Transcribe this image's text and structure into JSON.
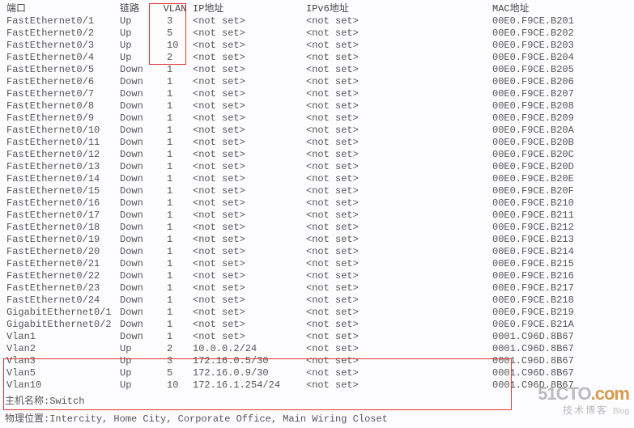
{
  "headers": {
    "port": "端口",
    "link": "链路",
    "vlan": "VLAN",
    "ip": "IP地址",
    "ipv6": "IPv6地址",
    "mac": "MAC地址"
  },
  "rows": [
    {
      "port": "FastEthernet0/1",
      "link": "Up",
      "vlan": "3",
      "ip": "<not set>",
      "ipv6": "<not set>",
      "mac": "00E0.F9CE.B201"
    },
    {
      "port": "FastEthernet0/2",
      "link": "Up",
      "vlan": "5",
      "ip": "<not set>",
      "ipv6": "<not set>",
      "mac": "00E0.F9CE.B202"
    },
    {
      "port": "FastEthernet0/3",
      "link": "Up",
      "vlan": "10",
      "ip": "<not set>",
      "ipv6": "<not set>",
      "mac": "00E0.F9CE.B203"
    },
    {
      "port": "FastEthernet0/4",
      "link": "Up",
      "vlan": "2",
      "ip": "<not set>",
      "ipv6": "<not set>",
      "mac": "00E0.F9CE.B204"
    },
    {
      "port": "FastEthernet0/5",
      "link": "Down",
      "vlan": "1",
      "ip": "<not set>",
      "ipv6": "<not set>",
      "mac": "00E0.F9CE.B205"
    },
    {
      "port": "FastEthernet0/6",
      "link": "Down",
      "vlan": "1",
      "ip": "<not set>",
      "ipv6": "<not set>",
      "mac": "00E0.F9CE.B206"
    },
    {
      "port": "FastEthernet0/7",
      "link": "Down",
      "vlan": "1",
      "ip": "<not set>",
      "ipv6": "<not set>",
      "mac": "00E0.F9CE.B207"
    },
    {
      "port": "FastEthernet0/8",
      "link": "Down",
      "vlan": "1",
      "ip": "<not set>",
      "ipv6": "<not set>",
      "mac": "00E0.F9CE.B208"
    },
    {
      "port": "FastEthernet0/9",
      "link": "Down",
      "vlan": "1",
      "ip": "<not set>",
      "ipv6": "<not set>",
      "mac": "00E0.F9CE.B209"
    },
    {
      "port": "FastEthernet0/10",
      "link": "Down",
      "vlan": "1",
      "ip": "<not set>",
      "ipv6": "<not set>",
      "mac": "00E0.F9CE.B20A"
    },
    {
      "port": "FastEthernet0/11",
      "link": "Down",
      "vlan": "1",
      "ip": "<not set>",
      "ipv6": "<not set>",
      "mac": "00E0.F9CE.B20B"
    },
    {
      "port": "FastEthernet0/12",
      "link": "Down",
      "vlan": "1",
      "ip": "<not set>",
      "ipv6": "<not set>",
      "mac": "00E0.F9CE.B20C"
    },
    {
      "port": "FastEthernet0/13",
      "link": "Down",
      "vlan": "1",
      "ip": "<not set>",
      "ipv6": "<not set>",
      "mac": "00E0.F9CE.B20D"
    },
    {
      "port": "FastEthernet0/14",
      "link": "Down",
      "vlan": "1",
      "ip": "<not set>",
      "ipv6": "<not set>",
      "mac": "00E0.F9CE.B20E"
    },
    {
      "port": "FastEthernet0/15",
      "link": "Down",
      "vlan": "1",
      "ip": "<not set>",
      "ipv6": "<not set>",
      "mac": "00E0.F9CE.B20F"
    },
    {
      "port": "FastEthernet0/16",
      "link": "Down",
      "vlan": "1",
      "ip": "<not set>",
      "ipv6": "<not set>",
      "mac": "00E0.F9CE.B210"
    },
    {
      "port": "FastEthernet0/17",
      "link": "Down",
      "vlan": "1",
      "ip": "<not set>",
      "ipv6": "<not set>",
      "mac": "00E0.F9CE.B211"
    },
    {
      "port": "FastEthernet0/18",
      "link": "Down",
      "vlan": "1",
      "ip": "<not set>",
      "ipv6": "<not set>",
      "mac": "00E0.F9CE.B212"
    },
    {
      "port": "FastEthernet0/19",
      "link": "Down",
      "vlan": "1",
      "ip": "<not set>",
      "ipv6": "<not set>",
      "mac": "00E0.F9CE.B213"
    },
    {
      "port": "FastEthernet0/20",
      "link": "Down",
      "vlan": "1",
      "ip": "<not set>",
      "ipv6": "<not set>",
      "mac": "00E0.F9CE.B214"
    },
    {
      "port": "FastEthernet0/21",
      "link": "Down",
      "vlan": "1",
      "ip": "<not set>",
      "ipv6": "<not set>",
      "mac": "00E0.F9CE.B215"
    },
    {
      "port": "FastEthernet0/22",
      "link": "Down",
      "vlan": "1",
      "ip": "<not set>",
      "ipv6": "<not set>",
      "mac": "00E0.F9CE.B216"
    },
    {
      "port": "FastEthernet0/23",
      "link": "Down",
      "vlan": "1",
      "ip": "<not set>",
      "ipv6": "<not set>",
      "mac": "00E0.F9CE.B217"
    },
    {
      "port": "FastEthernet0/24",
      "link": "Down",
      "vlan": "1",
      "ip": "<not set>",
      "ipv6": "<not set>",
      "mac": "00E0.F9CE.B218"
    },
    {
      "port": "GigabitEthernet0/1",
      "link": "Down",
      "vlan": "1",
      "ip": "<not set>",
      "ipv6": "<not set>",
      "mac": "00E0.F9CE.B219"
    },
    {
      "port": "GigabitEthernet0/2",
      "link": "Down",
      "vlan": "1",
      "ip": "<not set>",
      "ipv6": "<not set>",
      "mac": "00E0.F9CE.B21A"
    },
    {
      "port": "Vlan1",
      "link": "Down",
      "vlan": "1",
      "ip": "<not set>",
      "ipv6": "<not set>",
      "mac": "0001.C96D.8B67"
    },
    {
      "port": "Vlan2",
      "link": "Up",
      "vlan": "2",
      "ip": "10.0.0.2/24",
      "ipv6": "<not set>",
      "mac": "0001.C96D.8B67"
    },
    {
      "port": "Vlan3",
      "link": "Up",
      "vlan": "3",
      "ip": "172.16.0.5/30",
      "ipv6": "<not set>",
      "mac": "0001.C96D.8B67"
    },
    {
      "port": "Vlan5",
      "link": "Up",
      "vlan": "5",
      "ip": "172.16.0.9/30",
      "ipv6": "<not set>",
      "mac": "0001.C96D.8B67"
    },
    {
      "port": "Vlan10",
      "link": "Up",
      "vlan": "10",
      "ip": "172.16.1.254/24",
      "ipv6": "<not set>",
      "mac": "0001.C96D.8B67"
    }
  ],
  "footer": {
    "hostname_label": "主机名称:",
    "hostname_value": "Switch",
    "location_label": "物理位置:",
    "location_value": "Intercity, Home City, Corporate Office, Main Wiring Closet"
  },
  "watermark": {
    "brand_left": "51CTO",
    "brand_right": ".com",
    "sub": "技术博客",
    "blog": "Blog"
  }
}
